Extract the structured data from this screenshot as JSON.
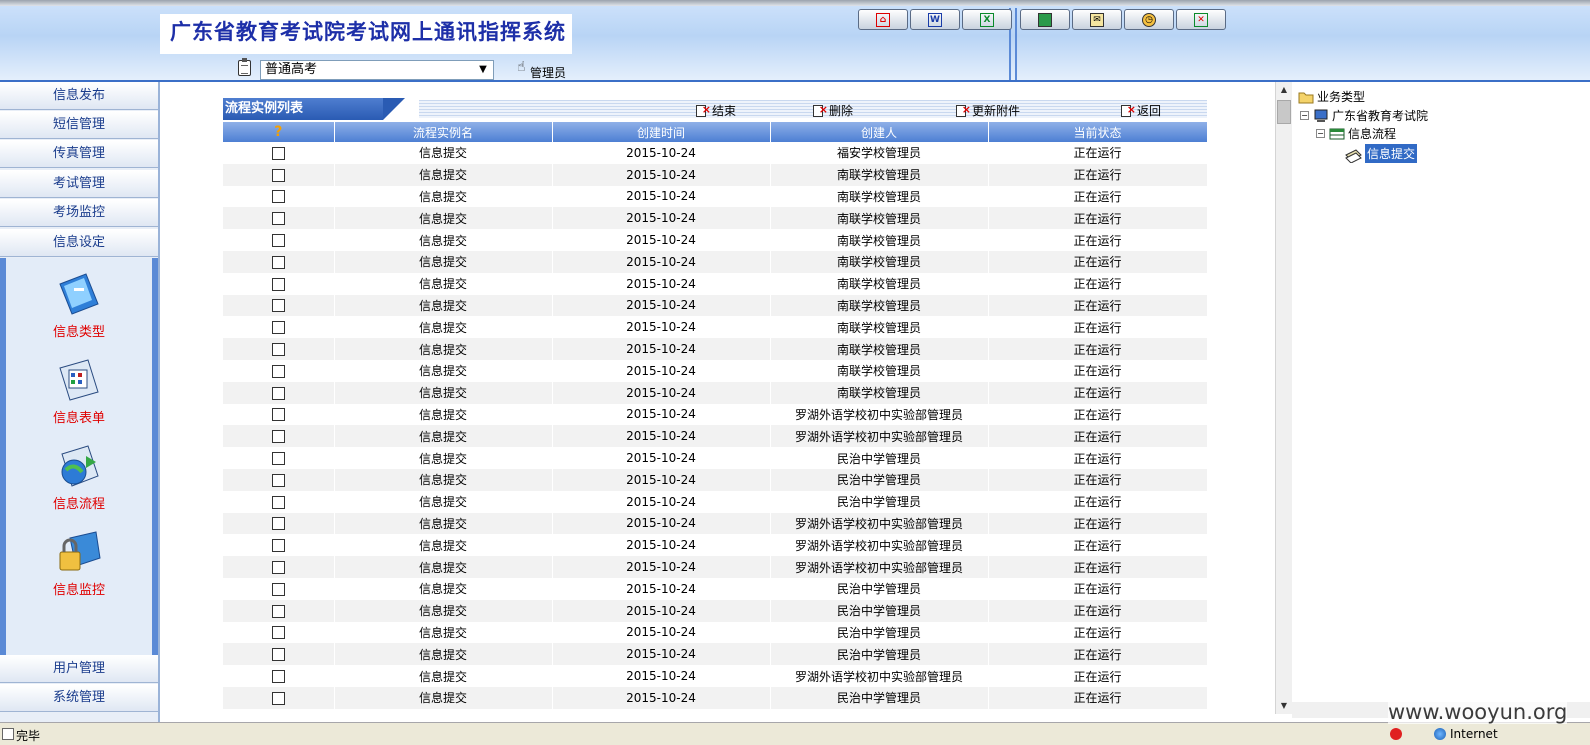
{
  "header": {
    "title": "广东省教育考试院考试网上通讯指挥系统",
    "exam_select": "普通高考",
    "user": "管理员",
    "toolbar": [
      "home-icon",
      "word-icon",
      "excel-icon",
      "book-icon",
      "mail-icon",
      "clock-icon",
      "exit-icon"
    ]
  },
  "nav": {
    "top": [
      "信息发布",
      "短信管理",
      "传真管理",
      "考试管理",
      "考场监控",
      "信息设定"
    ],
    "panel": [
      "信息类型",
      "信息表单",
      "信息流程",
      "信息监控"
    ],
    "bottom": [
      "用户管理",
      "系统管理"
    ]
  },
  "list": {
    "title": "流程实例列表",
    "actions": [
      "结束",
      "删除",
      "更新附件",
      "返回"
    ],
    "columns": [
      "?",
      "流程实例名",
      "创建时间",
      "创建人",
      "当前状态"
    ],
    "rows": [
      {
        "name": "信息提交",
        "time": "2015-10-24",
        "creator": "福安学校管理员",
        "status": "正在运行"
      },
      {
        "name": "信息提交",
        "time": "2015-10-24",
        "creator": "南联学校管理员",
        "status": "正在运行"
      },
      {
        "name": "信息提交",
        "time": "2015-10-24",
        "creator": "南联学校管理员",
        "status": "正在运行"
      },
      {
        "name": "信息提交",
        "time": "2015-10-24",
        "creator": "南联学校管理员",
        "status": "正在运行"
      },
      {
        "name": "信息提交",
        "time": "2015-10-24",
        "creator": "南联学校管理员",
        "status": "正在运行"
      },
      {
        "name": "信息提交",
        "time": "2015-10-24",
        "creator": "南联学校管理员",
        "status": "正在运行"
      },
      {
        "name": "信息提交",
        "time": "2015-10-24",
        "creator": "南联学校管理员",
        "status": "正在运行"
      },
      {
        "name": "信息提交",
        "time": "2015-10-24",
        "creator": "南联学校管理员",
        "status": "正在运行"
      },
      {
        "name": "信息提交",
        "time": "2015-10-24",
        "creator": "南联学校管理员",
        "status": "正在运行"
      },
      {
        "name": "信息提交",
        "time": "2015-10-24",
        "creator": "南联学校管理员",
        "status": "正在运行"
      },
      {
        "name": "信息提交",
        "time": "2015-10-24",
        "creator": "南联学校管理员",
        "status": "正在运行"
      },
      {
        "name": "信息提交",
        "time": "2015-10-24",
        "creator": "南联学校管理员",
        "status": "正在运行"
      },
      {
        "name": "信息提交",
        "time": "2015-10-24",
        "creator": "罗湖外语学校初中实验部管理员",
        "status": "正在运行"
      },
      {
        "name": "信息提交",
        "time": "2015-10-24",
        "creator": "罗湖外语学校初中实验部管理员",
        "status": "正在运行"
      },
      {
        "name": "信息提交",
        "time": "2015-10-24",
        "creator": "民治中学管理员",
        "status": "正在运行"
      },
      {
        "name": "信息提交",
        "time": "2015-10-24",
        "creator": "民治中学管理员",
        "status": "正在运行"
      },
      {
        "name": "信息提交",
        "time": "2015-10-24",
        "creator": "民治中学管理员",
        "status": "正在运行"
      },
      {
        "name": "信息提交",
        "time": "2015-10-24",
        "creator": "罗湖外语学校初中实验部管理员",
        "status": "正在运行"
      },
      {
        "name": "信息提交",
        "time": "2015-10-24",
        "creator": "罗湖外语学校初中实验部管理员",
        "status": "正在运行"
      },
      {
        "name": "信息提交",
        "time": "2015-10-24",
        "creator": "罗湖外语学校初中实验部管理员",
        "status": "正在运行"
      },
      {
        "name": "信息提交",
        "time": "2015-10-24",
        "creator": "民治中学管理员",
        "status": "正在运行"
      },
      {
        "name": "信息提交",
        "time": "2015-10-24",
        "creator": "民治中学管理员",
        "status": "正在运行"
      },
      {
        "name": "信息提交",
        "time": "2015-10-24",
        "creator": "民治中学管理员",
        "status": "正在运行"
      },
      {
        "name": "信息提交",
        "time": "2015-10-24",
        "creator": "民治中学管理员",
        "status": "正在运行"
      },
      {
        "name": "信息提交",
        "time": "2015-10-24",
        "creator": "罗湖外语学校初中实验部管理员",
        "status": "正在运行"
      },
      {
        "name": "信息提交",
        "time": "2015-10-24",
        "creator": "民治中学管理员",
        "status": "正在运行"
      }
    ]
  },
  "tree": {
    "root": "业务类型",
    "org": "广东省教育考试院",
    "flow": "信息流程",
    "selected": "信息提交"
  },
  "status": {
    "text": "完毕",
    "zone": "Internet"
  },
  "watermark": "www.wooyun.org",
  "colors": {
    "accent": "#3b6fc7",
    "title": "#1d2fa8",
    "panel_label": "#e00000",
    "selection": "#316ac5"
  }
}
